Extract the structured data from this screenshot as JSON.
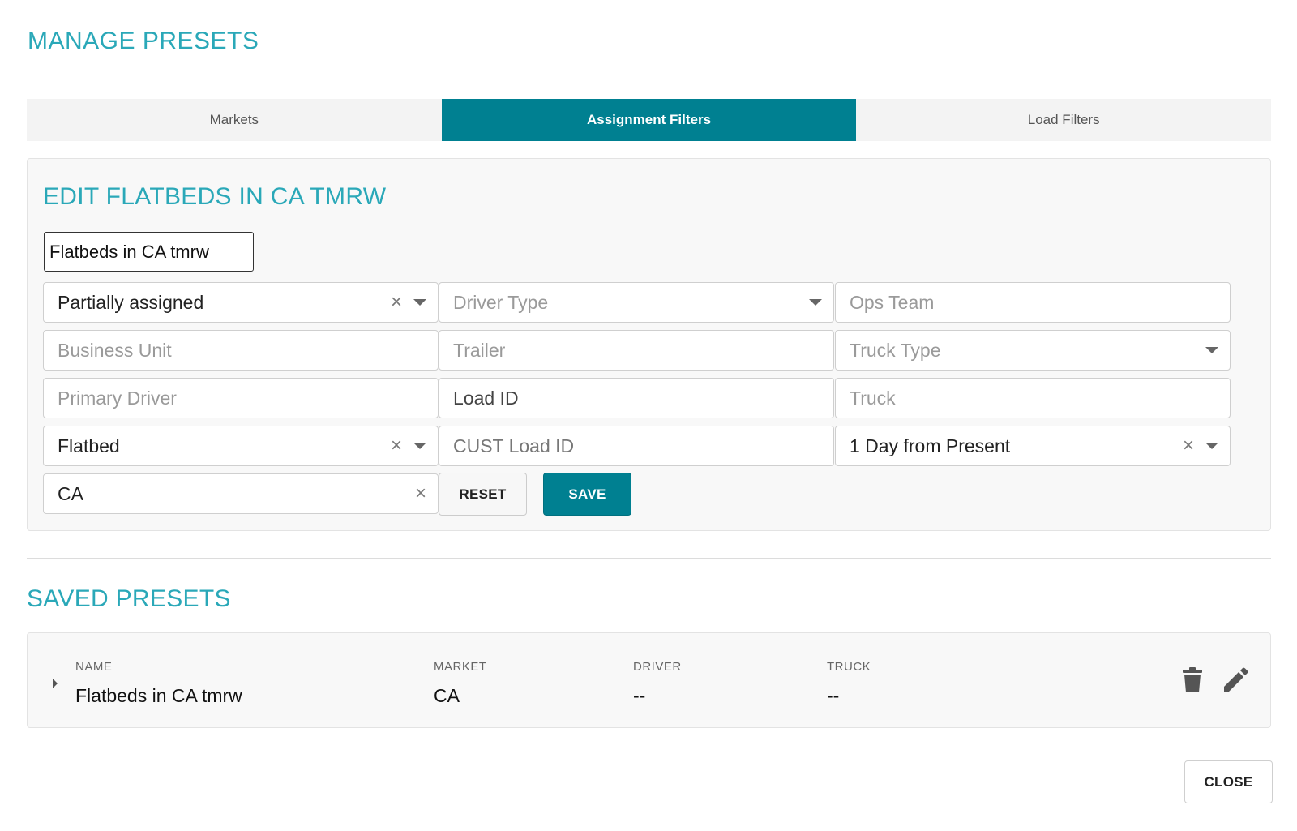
{
  "page": {
    "title": "MANAGE PRESETS"
  },
  "tabs": [
    {
      "label": "Markets",
      "active": false
    },
    {
      "label": "Assignment Filters",
      "active": true
    },
    {
      "label": "Load Filters",
      "active": false
    }
  ],
  "edit": {
    "title": "EDIT FLATBEDS IN CA TMRW",
    "name_value": "Flatbeds in CA tmrw",
    "fields": {
      "assignment_status": {
        "value": "Partially assigned"
      },
      "driver_type": {
        "placeholder": "Driver Type"
      },
      "ops_team": {
        "placeholder": "Ops Team"
      },
      "business_unit": {
        "placeholder": "Business Unit"
      },
      "trailer": {
        "placeholder": "Trailer"
      },
      "truck_type": {
        "placeholder": "Truck Type"
      },
      "primary_driver": {
        "placeholder": "Primary Driver"
      },
      "load_id": {
        "value": "Load ID"
      },
      "truck": {
        "placeholder": "Truck"
      },
      "equipment": {
        "value": "Flatbed"
      },
      "cust_load_id": {
        "placeholder": "CUST Load ID"
      },
      "date_range": {
        "value": "1 Day from Present"
      },
      "market": {
        "value": "CA"
      }
    },
    "reset_label": "RESET",
    "save_label": "SAVE"
  },
  "saved": {
    "title": "SAVED PRESETS",
    "headers": {
      "name": "NAME",
      "market": "MARKET",
      "driver": "DRIVER",
      "truck": "TRUCK"
    },
    "rows": [
      {
        "name": "Flatbeds in CA tmrw",
        "market": "CA",
        "driver": "--",
        "truck": "--"
      }
    ],
    "icons": {
      "delete": "trash-icon",
      "edit": "pencil-icon"
    }
  },
  "footer": {
    "close_label": "CLOSE"
  },
  "colors": {
    "accent": "#008091",
    "title": "#2aa8b8"
  }
}
